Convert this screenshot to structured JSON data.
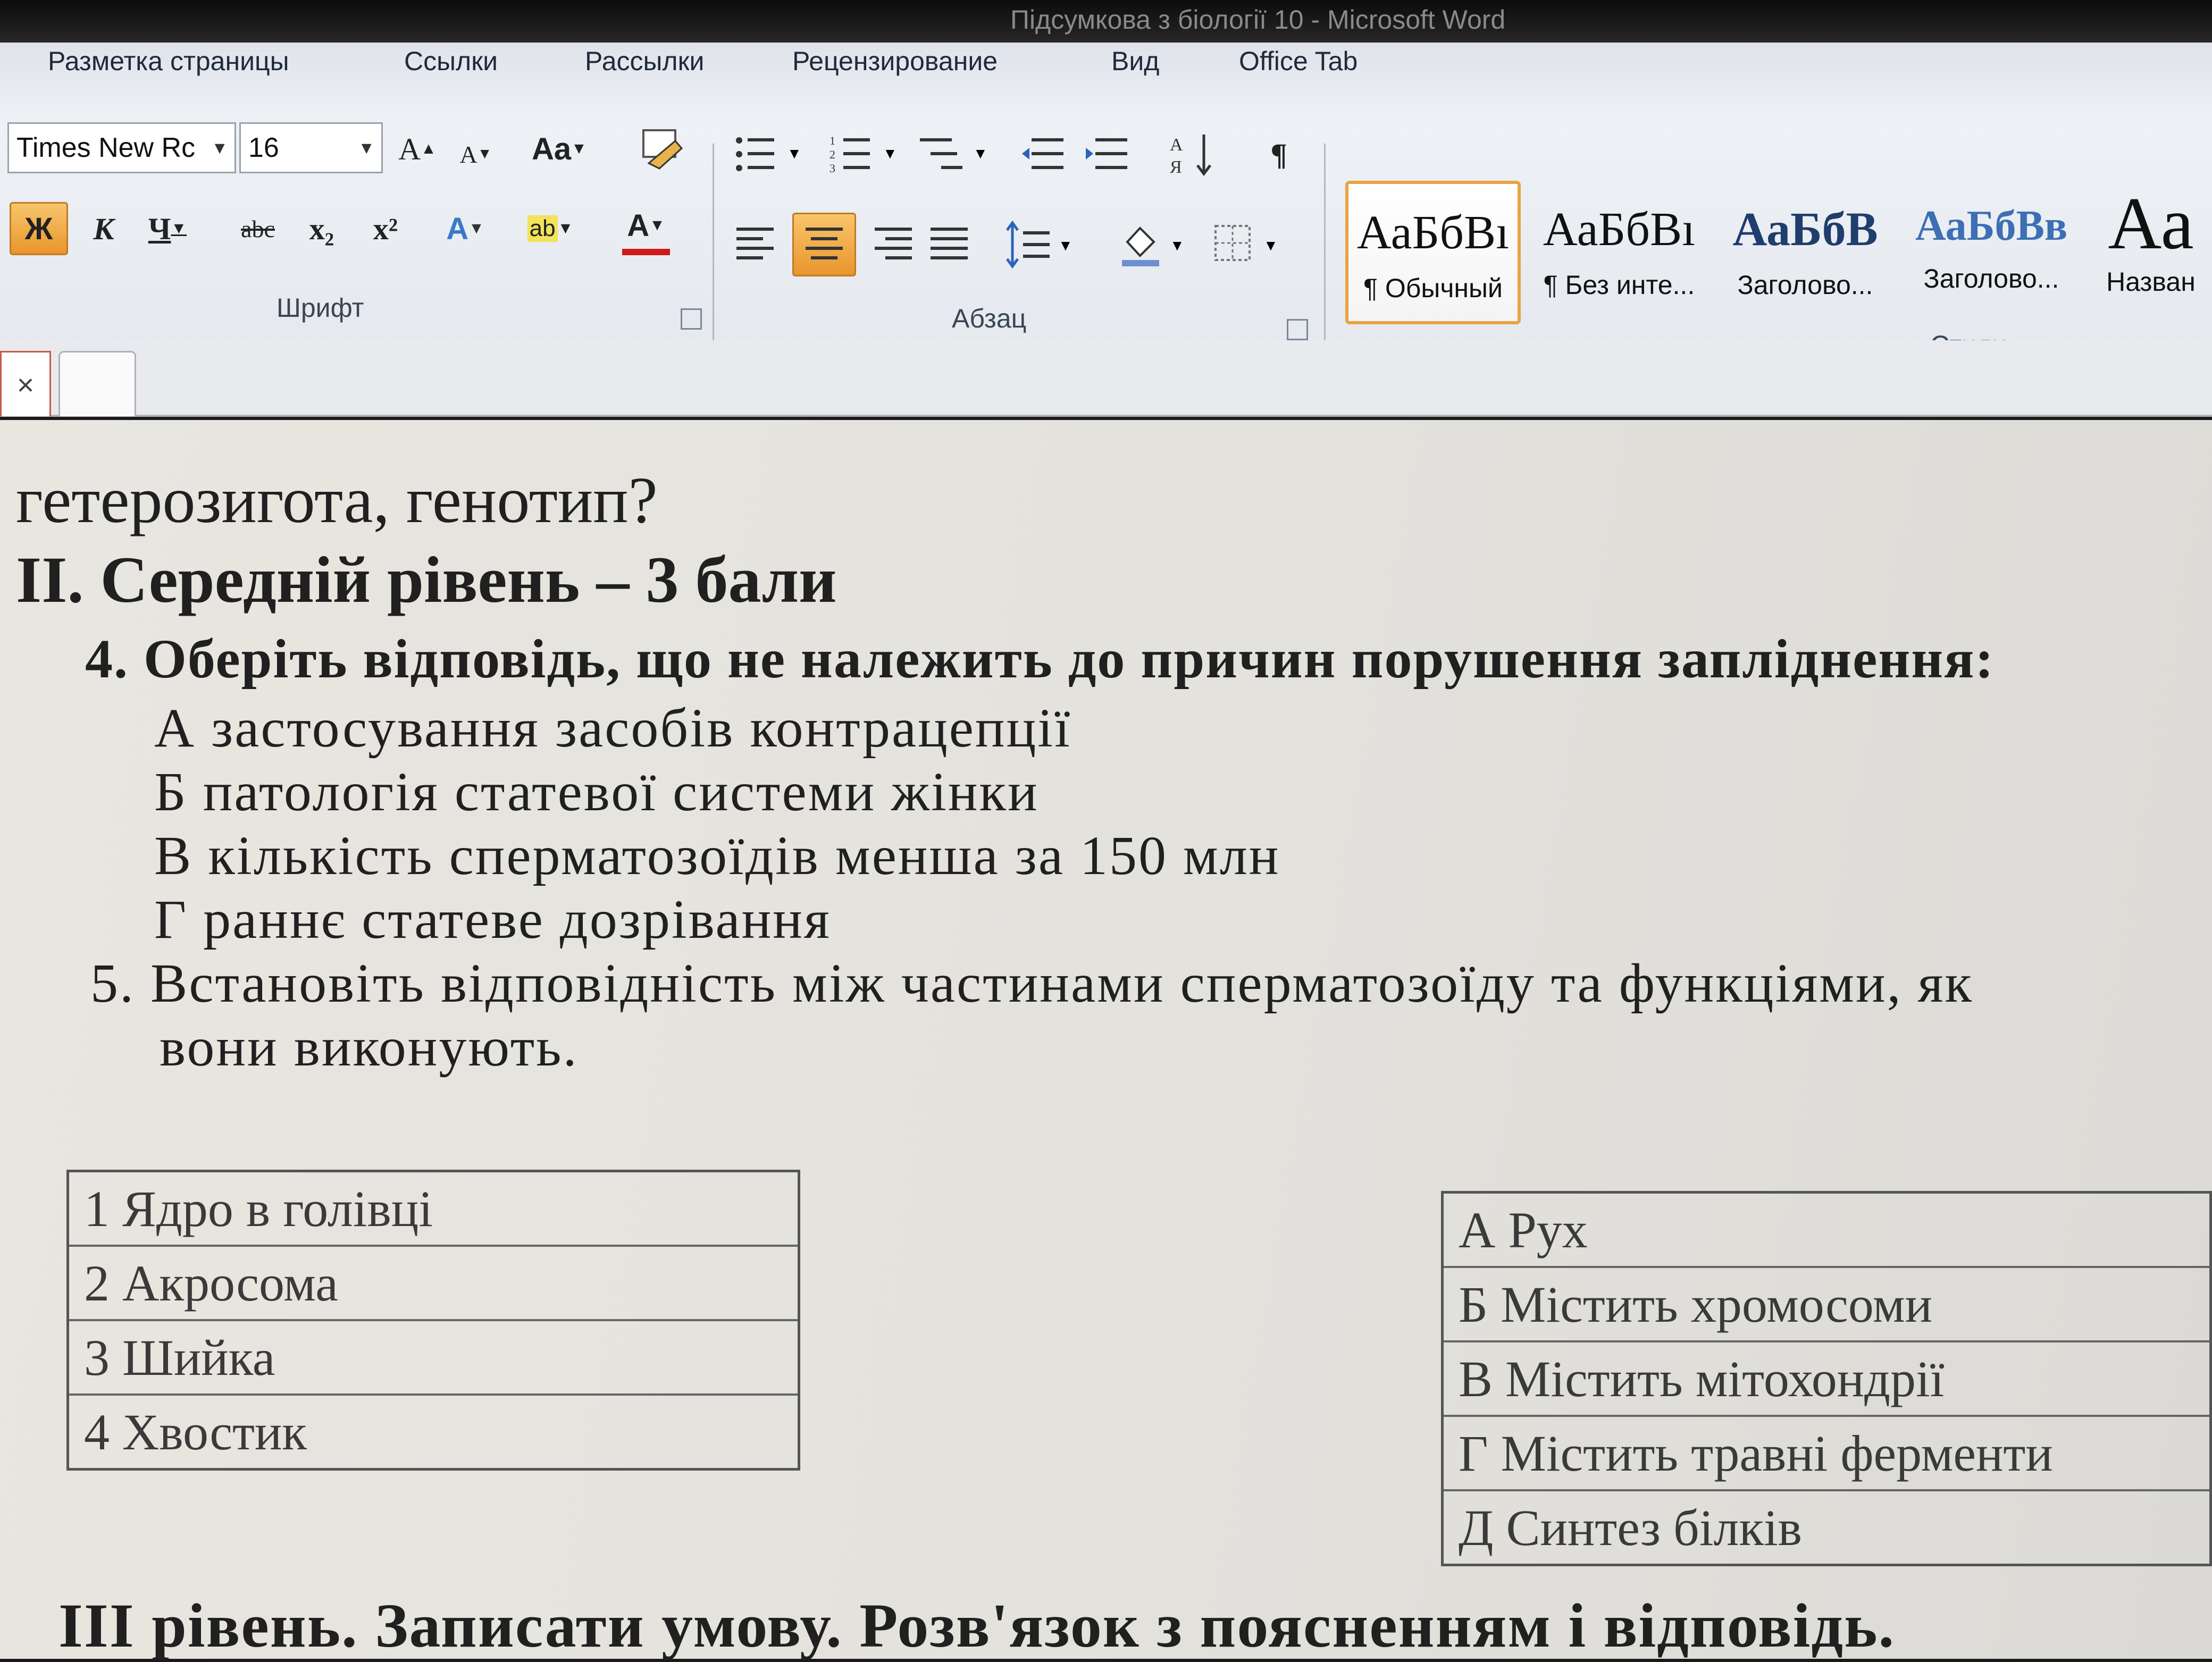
{
  "window": {
    "title": "Підсумкова з біології 10 - Microsoft Word"
  },
  "ribbon_tabs": [
    "Разметка страницы",
    "Ссылки",
    "Рассылки",
    "Рецензирование",
    "Вид",
    "Office Tab"
  ],
  "font_group": {
    "font_name": "Times New Rc",
    "font_size": "16",
    "label": "Шрифт",
    "buttons": {
      "grow": "A",
      "shrink": "A",
      "change_case": "Aa",
      "bold": "Ж",
      "italic": "К",
      "underline": "Ч",
      "strike": "abc",
      "subscript": "x₂",
      "superscript": "x²",
      "text_effects": "A",
      "highlight": "ab",
      "font_color": "A"
    }
  },
  "paragraph_group": {
    "label": "Абзац",
    "pilcrow": "¶"
  },
  "styles_group": {
    "label": "Стили",
    "styles": [
      {
        "sample": "АаБбВı",
        "name": "¶ Обычный"
      },
      {
        "sample": "АаБбВı",
        "name": "¶ Без инте..."
      },
      {
        "sample": "АаБбВ",
        "name": "Заголово..."
      },
      {
        "sample": "АаБбВв",
        "name": "Заголово..."
      },
      {
        "sample": "Аа",
        "name": "Назван"
      }
    ]
  },
  "doc_tab": {
    "close": "×"
  },
  "document": {
    "line_top": "гетерозигота, генотип?",
    "section_2": "II. Середній рівень – 3 бали",
    "q4": "4. Оберіть відповідь, що не належить до причин порушення запліднення:",
    "q4_options": [
      "А застосування засобів контрацепції",
      "Б патологія статевої системи жінки",
      "В кількість сперматозоїдів менша за 150 млн",
      "Г раннє статеве дозрівання"
    ],
    "q5_line1": "5. Встановіть відповідність між частинами сперматозоїду та функціями, як",
    "q5_line2": "вони виконують.",
    "table_left": [
      "1 Ядро в голівці",
      "2 Акросома",
      "3 Шийка",
      "4 Хвостик"
    ],
    "table_right": [
      "А Рух",
      "Б Містить хромосоми",
      "В Містить мітохондрії",
      "Г Містить травні ферменти",
      "Д Синтез білків"
    ],
    "section_3": "III рівень. Записати умову. Розв'язок з поясненням і відповідь."
  },
  "colors": {
    "accent_orange": "#e9a343",
    "font_color_red": "#d01818",
    "ribbon_bg": "#e4e8ee"
  }
}
